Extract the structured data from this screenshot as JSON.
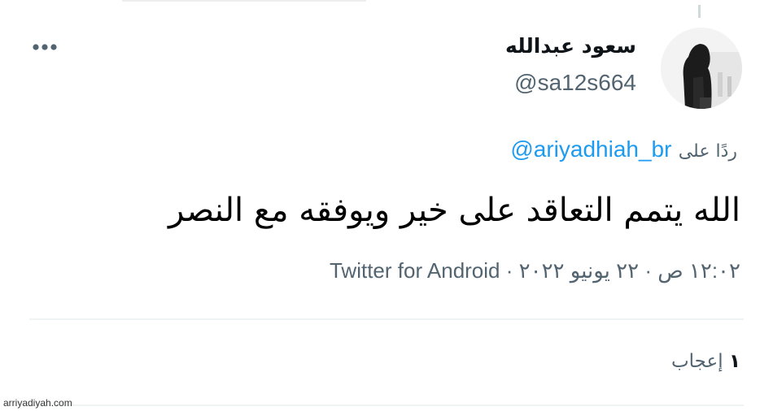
{
  "tweet": {
    "author": {
      "display_name": "سعود عبدالله",
      "handle": "@sa12s664",
      "avatar_icon": "person-silhouette-avatar"
    },
    "more_icon": "more-horizontal-icon",
    "reply": {
      "prefix": "ردًا على",
      "mention": "@ariyadhiah_br"
    },
    "text": "الله يتمم التعاقد على خير ويوفقه مع النصر",
    "meta": {
      "time": "١٢:٠٢ ص",
      "date": "٢٢ يونيو ٢٠٢٢",
      "separator": "·",
      "source": "Twitter for Android"
    },
    "likes": {
      "count": "١",
      "label": "إعجاب"
    }
  },
  "watermark": "arriyadiyah.com",
  "colors": {
    "link": "#1d9bf0",
    "secondary_text": "#536471",
    "primary_text": "#0f1419",
    "divider": "#eff3f4"
  }
}
